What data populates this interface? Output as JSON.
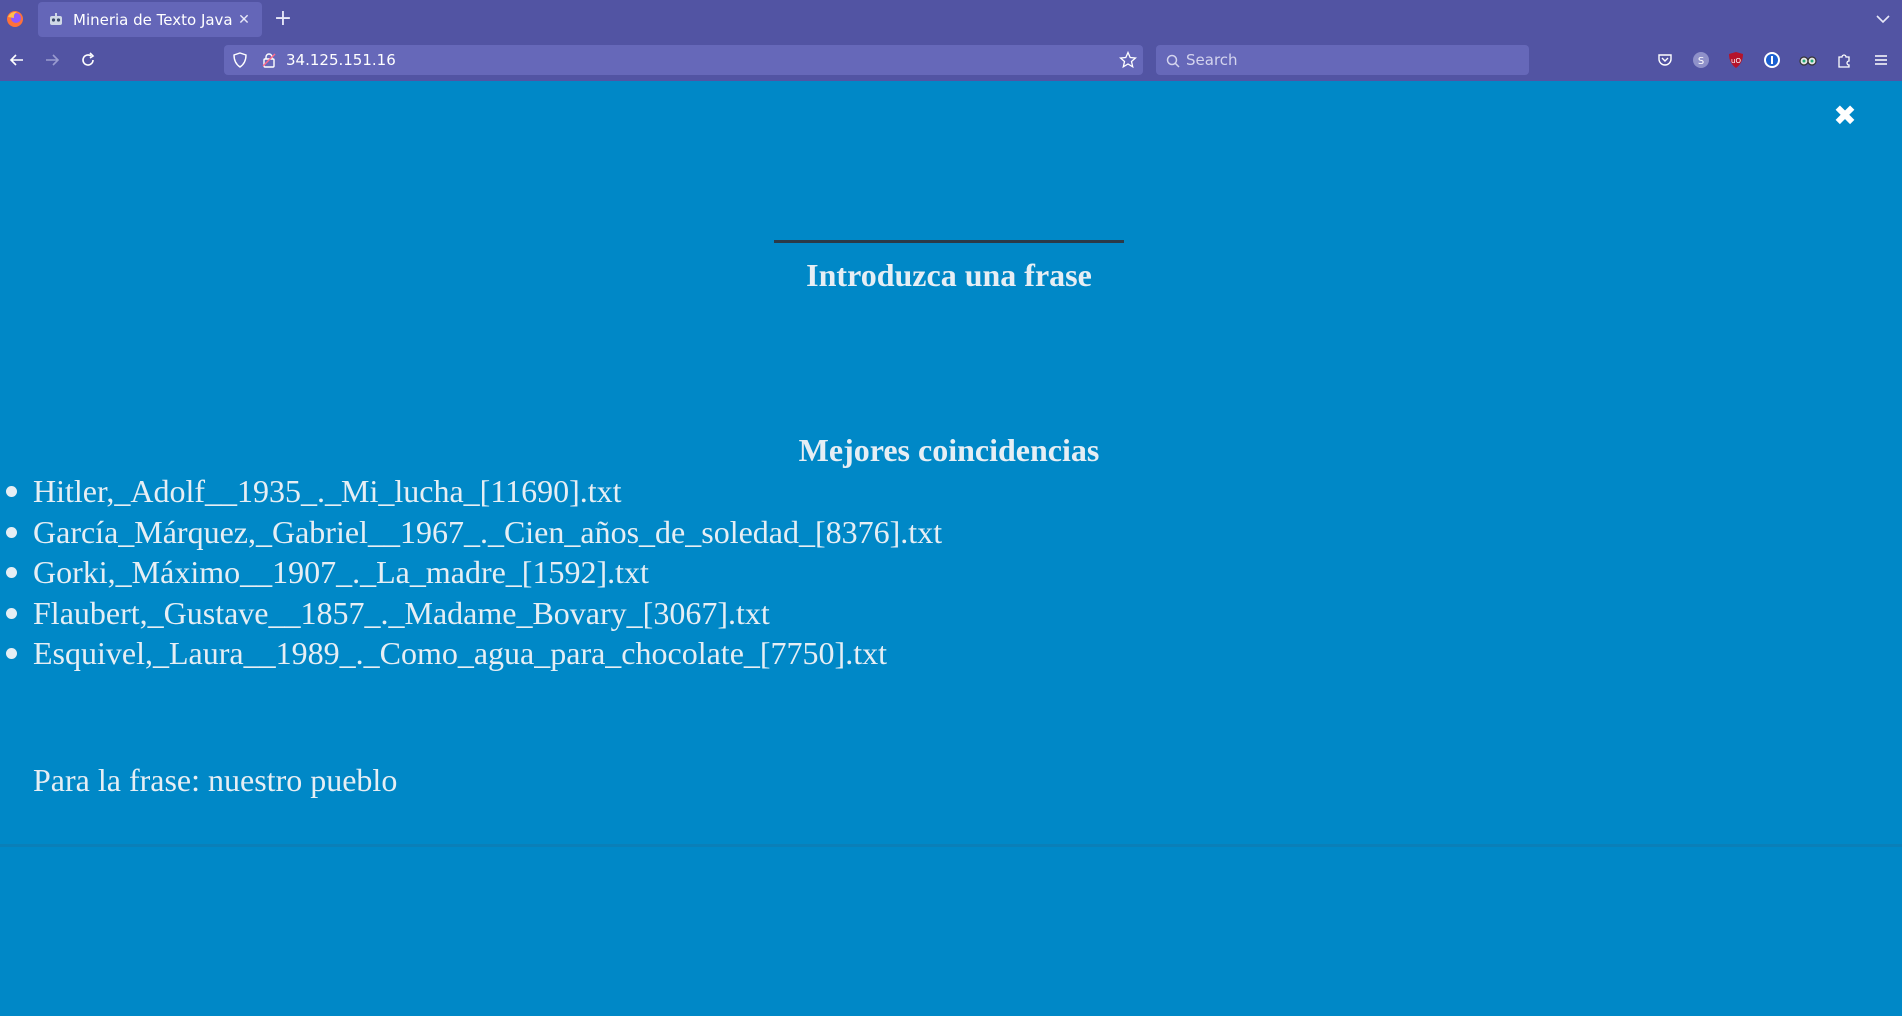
{
  "browser": {
    "tab": {
      "title": "Mineria de Texto Java"
    },
    "url": "34.125.151.16",
    "search_placeholder": "Search"
  },
  "page": {
    "prompt": "Introduzca una frase",
    "input_value": "",
    "results_title": "Mejores coincidencias",
    "results": [
      "Hitler,_Adolf__1935_._Mi_lucha_[11690].txt",
      "García_Márquez,_Gabriel__1967_._Cien_años_de_soledad_[8376].txt",
      "Gorki,_Máximo__1907_._La_madre_[1592].txt",
      "Flaubert,_Gustave__1857_._Madame_Bovary_[3067].txt",
      "Esquivel,_Laura__1989_._Como_agua_para_chocolate_[7750].txt"
    ],
    "phrase_text": "Para la frase: nuestro pueblo",
    "close_symbol": "✖"
  },
  "colors": {
    "chrome": "#5254a3",
    "page_background": "#0088c7",
    "text": "#e6eef4"
  }
}
